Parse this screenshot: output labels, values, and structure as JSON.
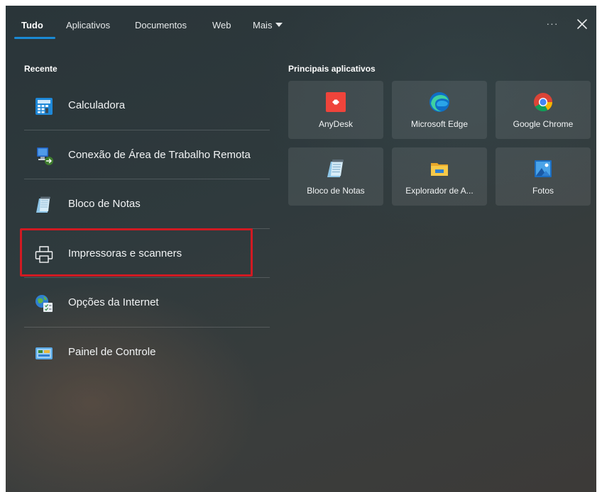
{
  "tabs": [
    {
      "label": "Tudo",
      "active": true
    },
    {
      "label": "Aplicativos",
      "active": false
    },
    {
      "label": "Documentos",
      "active": false
    },
    {
      "label": "Web",
      "active": false
    },
    {
      "label": "Mais",
      "active": false
    }
  ],
  "top_actions": {
    "more_options": "···",
    "close_icon": "close-icon"
  },
  "recent": {
    "title": "Recente",
    "items": [
      {
        "label": "Calculadora",
        "icon": "calculator-icon"
      },
      {
        "label": "Conexão de Área de Trabalho Remota",
        "icon": "remote-desktop-icon"
      },
      {
        "label": "Bloco de Notas",
        "icon": "notepad-icon"
      },
      {
        "label": "Impressoras e scanners",
        "icon": "printer-icon",
        "highlighted": true
      },
      {
        "label": "Opções da Internet",
        "icon": "internet-options-icon"
      },
      {
        "label": "Painel de Controle",
        "icon": "control-panel-icon"
      }
    ]
  },
  "top_apps": {
    "title": "Principais aplicativos",
    "items": [
      {
        "label": "AnyDesk",
        "icon": "anydesk-icon"
      },
      {
        "label": "Microsoft Edge",
        "icon": "edge-icon"
      },
      {
        "label": "Google Chrome",
        "icon": "chrome-icon"
      },
      {
        "label": "Bloco de Notas",
        "icon": "notepad-icon"
      },
      {
        "label": "Explorador de A...",
        "icon": "file-explorer-icon"
      },
      {
        "label": "Fotos",
        "icon": "photos-icon"
      }
    ]
  },
  "colors": {
    "accent": "#1a8ad4",
    "highlight": "#d11a22",
    "anydesk": "#ef443b"
  }
}
